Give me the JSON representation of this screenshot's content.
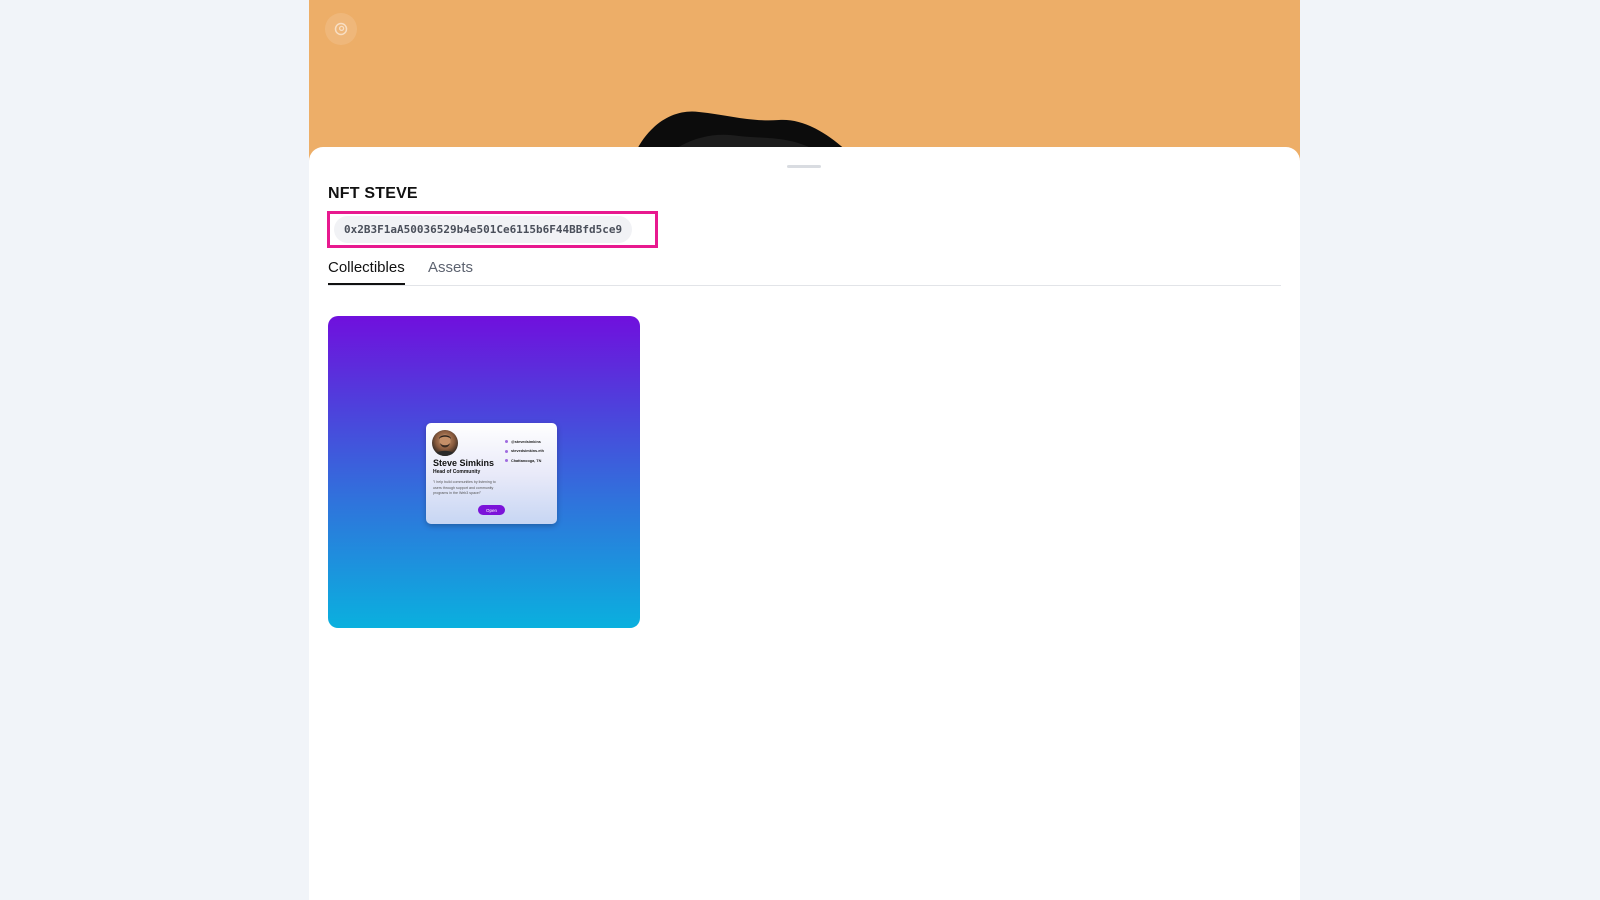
{
  "profile": {
    "name": "NFT STEVE",
    "address": "0x2B3F1aA50036529b4e501Ce6115b6F44BBfd5ce9"
  },
  "tabs": [
    {
      "label": "Collectibles",
      "active": true
    },
    {
      "label": "Assets",
      "active": false
    }
  ],
  "collectibles": [
    {
      "name": "Steve Simkins",
      "role": "Head of Community",
      "bio": "\"I help build communities by listening to users through support and community programs in the Web3 space!\"",
      "links": [
        "@stevedsimkins",
        "stevedsimkins.eth",
        "Chattanooga, TN"
      ],
      "button": "Open"
    }
  ],
  "colors": {
    "banner": "#edae68",
    "highlight": "#e8198f",
    "nft_gradient_top": "#7010dd",
    "nft_gradient_bottom": "#0ab0de",
    "open_button": "#7b13d9"
  },
  "icons": {
    "banner_logo": "pinata-logo-icon"
  }
}
